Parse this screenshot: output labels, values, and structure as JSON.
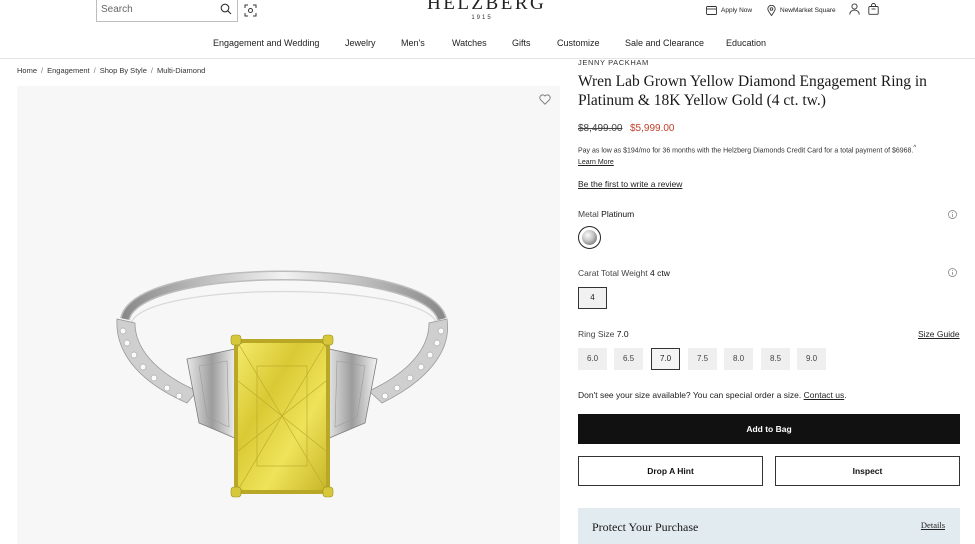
{
  "header": {
    "search_placeholder": "Search",
    "logo_wordmark": "HELZBERG",
    "logo_year": "1915",
    "apply_now": "Apply Now",
    "store": "NewMarket Square",
    "icons": [
      "search-icon",
      "camera-search-icon",
      "credit-card-icon",
      "location-pin-icon",
      "account-icon",
      "bag-icon"
    ]
  },
  "nav": {
    "items": [
      "Engagement and Wedding",
      "Jewelry",
      "Men's",
      "Watches",
      "Gifts",
      "Customize",
      "Sale and Clearance",
      "Education"
    ]
  },
  "breadcrumb": [
    "Home",
    "Engagement",
    "Shop By Style",
    "Multi-Diamond"
  ],
  "product": {
    "brand": "JENNY PACKHAM",
    "title": "Wren Lab Grown Yellow Diamond Engagement Ring in Platinum & 18K Yellow Gold (4 ct. tw.)",
    "price_was": "$8,499.00",
    "price_now": "$5,999.00",
    "finance_text": "Pay as low as $194/mo for 36 months with the Helzberg Diamonds Credit Card for a total payment of $6968.",
    "finance_mark": "^",
    "learn_more": "Learn More",
    "review_link": "Be the first to write a review",
    "metal_label": "Metal",
    "metal_value": "Platinum",
    "carat_label": "Carat Total Weight",
    "carat_value": "4 ctw",
    "carat_option": "4",
    "size_label": "Ring Size",
    "size_value": "7.0",
    "size_guide": "Size Guide",
    "sizes": [
      "6.0",
      "6.5",
      "7.0",
      "7.5",
      "8.0",
      "8.5",
      "9.0"
    ],
    "selected_size": "7.0",
    "special_order_text": "Don't see your size available? You can special order a size.",
    "contact_us": "Contact us",
    "special_order_end": ".",
    "add_to_bag": "Add to Bag",
    "drop_hint": "Drop A Hint",
    "inspect": "Inspect",
    "protect_title": "Protect Your Purchase",
    "protect_details": "Details"
  },
  "colors": {
    "sale_price": "#c2402a",
    "primary_button": "#111111",
    "protect_bg": "#e2ebf0",
    "gallery_bg": "#f7f7f7",
    "stone_yellow": "#e6d93a"
  }
}
